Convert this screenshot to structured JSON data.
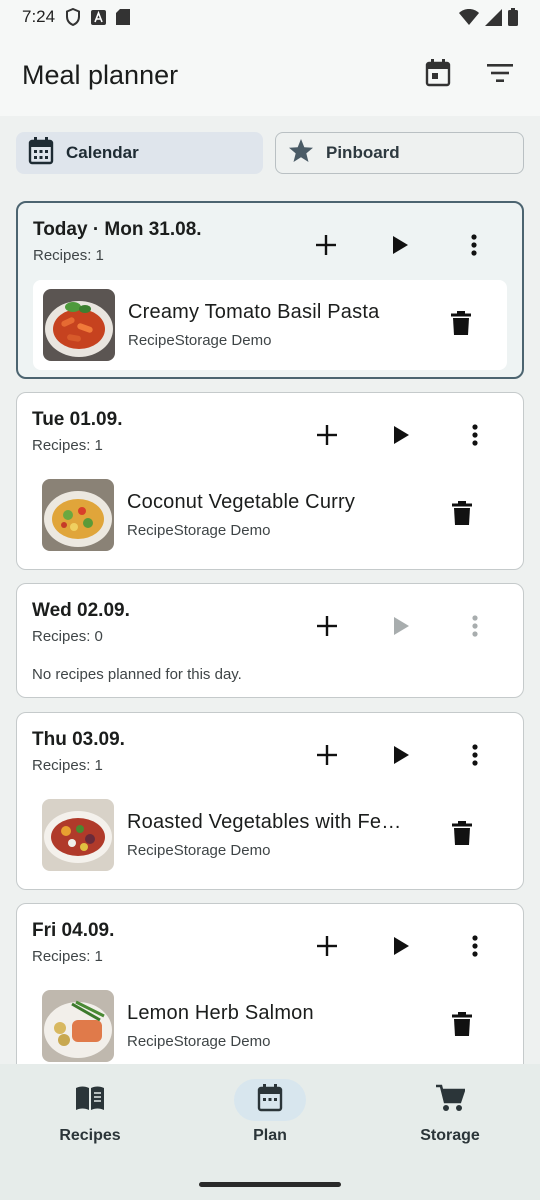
{
  "status_bar": {
    "time": "7:24"
  },
  "app_bar": {
    "title": "Meal planner",
    "actions": [
      "calendar-icon",
      "filter-icon"
    ]
  },
  "segments": [
    {
      "label": "Calendar",
      "icon": "calendar-month-icon",
      "selected": true
    },
    {
      "label": "Pinboard",
      "icon": "star-icon",
      "selected": false
    }
  ],
  "days": [
    {
      "title": "Today · Mon 31.08.",
      "count": "Recipes: 1",
      "recipes": [
        {
          "name": "Creamy Tomato Basil Pasta",
          "source": "RecipeStorage Demo"
        }
      ]
    },
    {
      "title": "Tue 01.09.",
      "count": "Recipes: 1",
      "recipes": [
        {
          "name": "Coconut Vegetable Curry",
          "source": "RecipeStorage Demo"
        }
      ]
    },
    {
      "title": "Wed 02.09.",
      "count": "Recipes: 0",
      "empty_text": "No recipes planned for this day."
    },
    {
      "title": "Thu 03.09.",
      "count": "Recipes: 1",
      "recipes": [
        {
          "name": "Roasted Vegetables with Fe…",
          "source": "RecipeStorage Demo"
        }
      ]
    },
    {
      "title": "Fri 04.09.",
      "count": "Recipes: 1",
      "recipes": [
        {
          "name": "Lemon Herb Salmon",
          "source": "RecipeStorage Demo"
        }
      ]
    }
  ],
  "bottom_nav": {
    "items": [
      {
        "label": "Recipes",
        "icon": "book-icon",
        "active": false
      },
      {
        "label": "Plan",
        "icon": "calendar-icon",
        "active": true
      },
      {
        "label": "Storage",
        "icon": "cart-icon",
        "active": false
      }
    ]
  }
}
